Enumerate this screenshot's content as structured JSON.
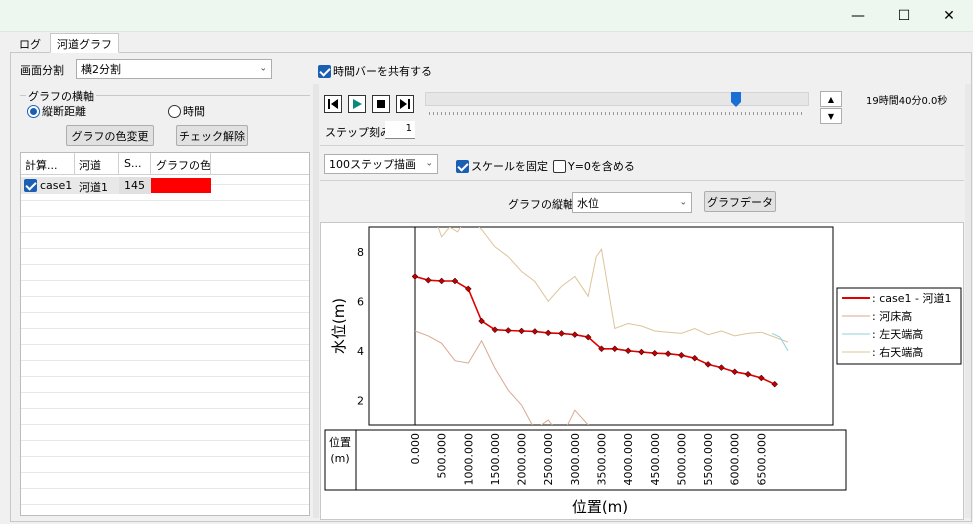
{
  "window": {
    "minimize_glyph": "—",
    "maximize_glyph": "☐",
    "close_glyph": "✕"
  },
  "tabs": [
    {
      "label": "ログ"
    },
    {
      "label": "河道グラフ"
    }
  ],
  "toolbar": {
    "split_label": "画面分割",
    "split_value": "横2分割",
    "share_timebar_label": "時間バーを共有する",
    "share_timebar_checked": true
  },
  "axis_group": {
    "title": "グラフの横軸",
    "option_distance": "縦断距離",
    "option_time": "時間",
    "selected": "distance"
  },
  "left_buttons": {
    "color_change": "グラフの色変更",
    "uncheck": "チェック解除"
  },
  "grid": {
    "headers": [
      "計算...",
      "河道",
      "S...",
      "グラフの色"
    ],
    "rows": [
      {
        "case": "case1",
        "river": "河道1",
        "s": "145",
        "color": "#ff0000",
        "checked": true
      }
    ]
  },
  "timebar": {
    "step_label": "ステップ刻み",
    "step_value": "1",
    "time_text": "19時間40分0.0秒",
    "slider_fraction": 0.81
  },
  "options": {
    "draw_steps": "100ステップ描画",
    "fix_scale_label": "スケールを固定",
    "fix_scale_checked": true,
    "include_zero_label": "Y=0を含める",
    "include_zero_checked": false
  },
  "vertical_axis": {
    "label": "グラフの縦軸",
    "value": "水位",
    "graph_data_button": "グラフデータ"
  },
  "chart_data": {
    "type": "line",
    "ylabel": "水位(m)",
    "xlabel": "位置(m)",
    "ylim": [
      1.0,
      9.0
    ],
    "xlim": [
      0,
      7700
    ],
    "yticks": [
      2,
      4,
      6,
      8
    ],
    "xticks": [
      "0.000",
      "500.000",
      "1000.000",
      "1500.000",
      "2000.000",
      "2500.000",
      "3000.000",
      "3500.000",
      "4000.000",
      "4500.000",
      "5000.000",
      "5500.000",
      "6000.000",
      "6500.000"
    ],
    "position_header": "位置\n(m)",
    "legend": [
      {
        "label": ": case1 - 河道1",
        "color": "#e00000"
      },
      {
        "label": ": 河床高",
        "color": "#d8a890"
      },
      {
        "label": ": 左天端高",
        "color": "#8fd0dc"
      },
      {
        "label": ": 右天端高",
        "color": "#dcc49a"
      }
    ],
    "series": [
      {
        "name": "case1 - 河道1",
        "color": "#e00000",
        "markers": true,
        "x": [
          0,
          250,
          500,
          750,
          1000,
          1250,
          1500,
          1750,
          2000,
          2250,
          2500,
          2750,
          3000,
          3250,
          3500,
          3750,
          4000,
          4250,
          4500,
          4750,
          5000,
          5250,
          5500,
          5750,
          6000,
          6250,
          6500,
          6750
        ],
        "y": [
          7.0,
          6.85,
          6.82,
          6.82,
          6.5,
          5.2,
          4.85,
          4.82,
          4.8,
          4.78,
          4.72,
          4.7,
          4.65,
          4.55,
          4.08,
          4.08,
          4.0,
          3.95,
          3.9,
          3.88,
          3.82,
          3.7,
          3.45,
          3.32,
          3.15,
          3.05,
          2.9,
          2.65
        ]
      },
      {
        "name": "河床高",
        "color": "#d8a890",
        "markers": false,
        "x": [
          0,
          250,
          500,
          750,
          1000,
          1250,
          1500,
          1750,
          2000,
          2250,
          2500,
          2750,
          3000,
          3250,
          3500
        ],
        "y": [
          4.8,
          4.6,
          4.3,
          3.6,
          3.5,
          4.4,
          3.3,
          2.4,
          1.8,
          0.8,
          1.2,
          0.5,
          1.6,
          1.0,
          0.4
        ]
      },
      {
        "name": "左天端高",
        "color": "#8fd0dc",
        "markers": false,
        "x": [
          6700,
          6850,
          7000
        ],
        "y": [
          4.7,
          4.55,
          4.0
        ]
      },
      {
        "name": "右天端高",
        "color": "#dcc49a",
        "markers": false,
        "x": [
          350,
          500,
          650,
          800,
          1000,
          1250,
          1500,
          1750,
          2000,
          2250,
          2500,
          2750,
          3000,
          3250,
          3400,
          3500,
          3750,
          4000,
          4250,
          4500,
          4750,
          5000,
          5250,
          5500,
          5750,
          6000,
          6250,
          6500,
          6750,
          7000
        ],
        "y": [
          9.5,
          8.6,
          9.0,
          8.8,
          9.5,
          8.9,
          8.2,
          7.8,
          7.2,
          6.8,
          6.0,
          6.6,
          7.0,
          6.2,
          7.8,
          8.1,
          4.9,
          5.1,
          5.0,
          4.8,
          4.75,
          4.7,
          4.9,
          4.65,
          4.8,
          4.6,
          4.7,
          4.75,
          4.55,
          4.35
        ]
      }
    ]
  }
}
